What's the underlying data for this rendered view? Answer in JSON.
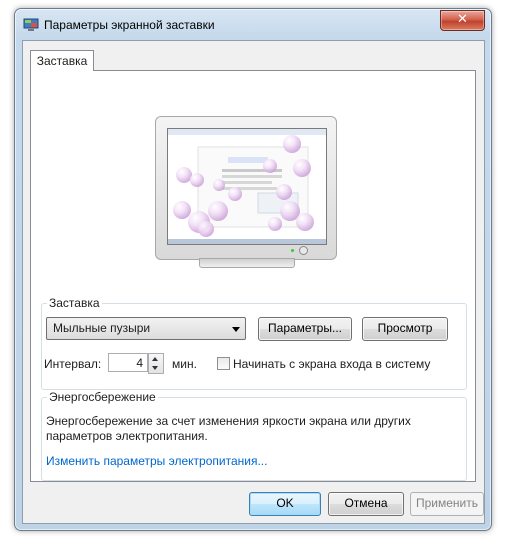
{
  "window": {
    "title": "Параметры экранной заставки",
    "close_glyph": "✕"
  },
  "tabs": [
    {
      "label": "Заставка"
    }
  ],
  "screensaver": {
    "group_label": "Заставка",
    "selected": "Мыльные пузыри",
    "settings_button": "Параметры...",
    "preview_button": "Просмотр",
    "interval_label": "Интервал:",
    "interval_value": "4",
    "interval_unit": "мин.",
    "logon_checkbox_label": "Начинать с экрана входа в систему",
    "logon_checked": false
  },
  "power": {
    "group_label": "Энергосбережение",
    "description_line1": "Энергосбережение за счет изменения яркости экрана или других",
    "description_line2": "параметров электропитания.",
    "link_text": "Изменить параметры электропитания..."
  },
  "footer": {
    "ok_label": "OK",
    "cancel_label": "Отмена",
    "apply_label": "Применить"
  }
}
